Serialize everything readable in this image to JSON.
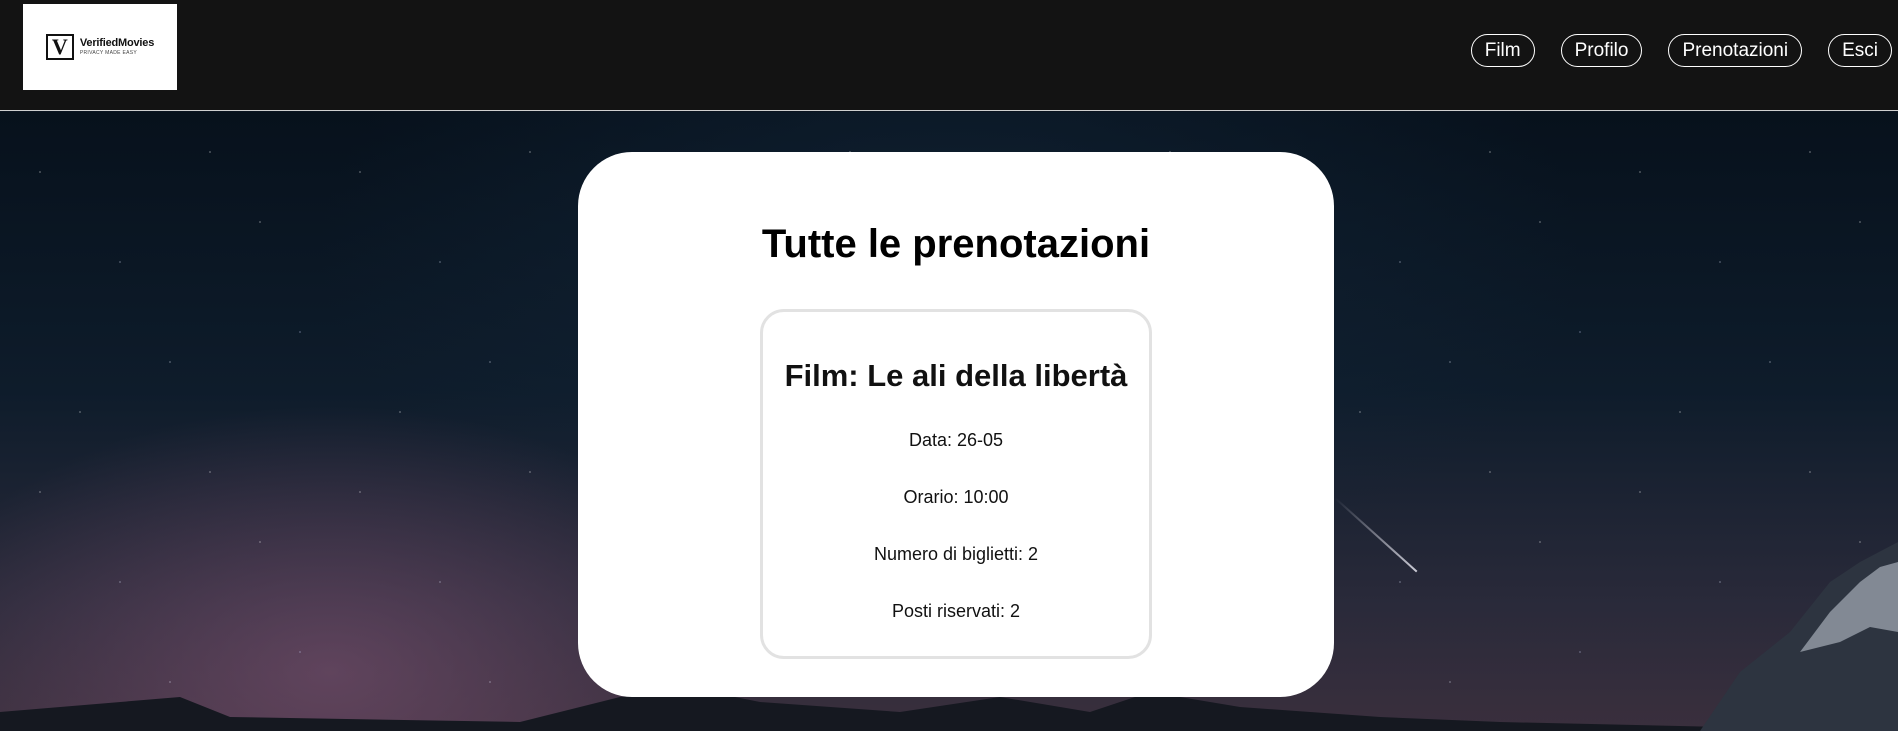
{
  "app": {
    "logo": {
      "mark": "V",
      "name": "VerifiedMovies",
      "tagline": "PRIVACY MADE EASY"
    }
  },
  "nav": {
    "items": [
      {
        "label": "Film"
      },
      {
        "label": "Profilo"
      },
      {
        "label": "Prenotazioni"
      },
      {
        "label": "Esci"
      }
    ]
  },
  "main": {
    "title": "Tutte le prenotazioni",
    "bookings": [
      {
        "film": "Film: Le ali della libertà",
        "date": "Data: 26-05",
        "time": "Orario: 10:00",
        "tickets": "Numero di biglietti: 2",
        "seats": "Posti riservati: 2"
      }
    ]
  },
  "colors": {
    "header_bg": "#131313",
    "panel_bg": "#ffffff",
    "nav_border": "#ffffff",
    "card_border": "#e2e2e2"
  }
}
